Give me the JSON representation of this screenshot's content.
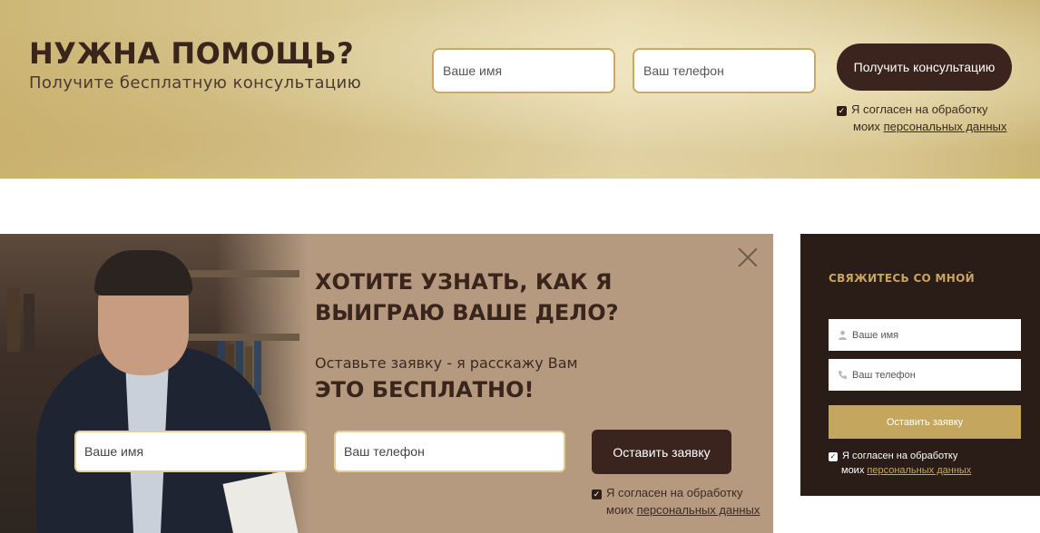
{
  "banner": {
    "title": "НУЖНА ПОМОЩЬ?",
    "subtitle": "Получите бесплатную консультацию",
    "name_placeholder": "Ваше имя",
    "phone_placeholder": "Ваш телефон",
    "submit_label": "Получить консультацию",
    "consent_text": "Я согласен на обработку",
    "consent_prefix": "моих",
    "consent_link": "персональных данных"
  },
  "popup": {
    "title": "ХОТИТЕ УЗНАТЬ, КАК Я ВЫИГРАЮ ВАШЕ ДЕЛО?",
    "subtitle": "Оставьте заявку - я расскажу Вам",
    "highlight": "ЭТО БЕСПЛАТНО!",
    "name_placeholder": "Ваше имя",
    "phone_placeholder": "Ваш телефон",
    "submit_label": "Оставить заявку",
    "consent_text": "Я согласен на обработку",
    "consent_prefix": "моих",
    "consent_link": "персональных данных",
    "close_icon": "close-icon"
  },
  "sidebar": {
    "title": "СВЯЖИТЕСЬ СО МНОЙ",
    "name_placeholder": "Ваше имя",
    "phone_placeholder": "Ваш телефон",
    "name_icon": "user-icon",
    "phone_icon": "phone-icon",
    "submit_label": "Оставить заявку",
    "consent_text": "Я согласен на обработку",
    "consent_prefix": "моих",
    "consent_link": "персональных данных"
  },
  "colors": {
    "dark_brown": "#3a241d",
    "gold": "#c4a65e",
    "popup_bg": "#b59a80",
    "sidebar_bg": "#2a1c16"
  }
}
